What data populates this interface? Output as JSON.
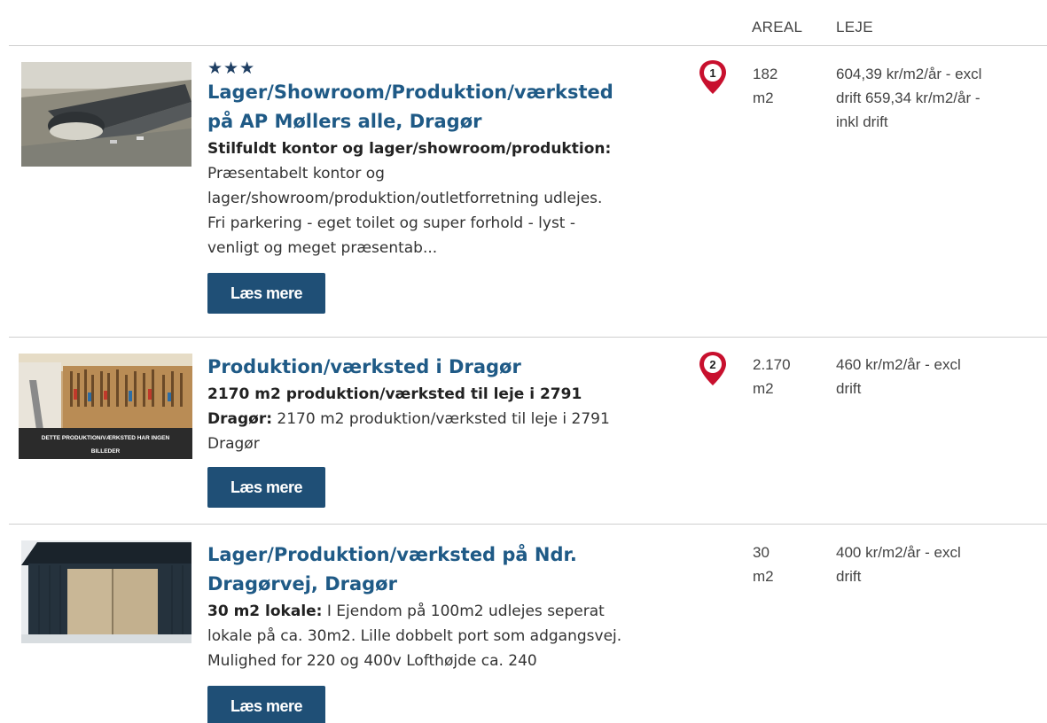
{
  "columns": {
    "areal": "AREAL",
    "leje": "LEJE"
  },
  "listings": [
    {
      "stars": "★★★",
      "title_line1": "Lager/Showroom/Produktion/værksted",
      "title_line2": "på AP Møllers alle, Dragør",
      "subtitle": "Stilfuldt kontor og lager/showroom/produktion:",
      "desc_lines": [
        "Præsentabelt kontor og",
        "lager/showroom/produktion/outletforretning udlejes.",
        "Fri parkering - eget toilet og super forhold - lyst -",
        "venligt og meget præsentab..."
      ],
      "button": "Læs mere",
      "pin_number": "1",
      "areal_lines": [
        "182",
        "m2"
      ],
      "leje_lines": [
        "604,39 kr/m2/år - excl",
        "drift 659,34 kr/m2/år -",
        "inkl drift"
      ]
    },
    {
      "title_line1": "Produktion/værksted i Dragør",
      "subtitle": "2170 m2 produktion/værksted til leje i 2791",
      "desc_bold": "Dragør:",
      "desc_rest": " 2170 m2 produktion/værksted til leje i 2791",
      "desc_line2": "Dragør",
      "image_caption_line1": "DETTE PRODUKTION/VÆRKSTED HAR INGEN",
      "image_caption_line2": "BILLEDER",
      "button": "Læs mere",
      "pin_number": "2",
      "areal_lines": [
        "2.170",
        "m2"
      ],
      "leje_lines": [
        "460 kr/m2/år - excl",
        "drift"
      ]
    },
    {
      "title_line1": "Lager/Produktion/værksted på Ndr.",
      "title_line2": "Dragørvej, Dragør",
      "desc_bold": "30 m2 lokale:",
      "desc_rest": " I Ejendom på 100m2 udlejes seperat",
      "desc_line2": "lokale på ca. 30m2. Lille dobbelt port som adgangsvej.",
      "desc_line3": "Mulighed for 220 og 400v  Lofthøjde ca. 240",
      "button": "Læs mere",
      "areal_lines": [
        "30",
        "m2"
      ],
      "leje_lines": [
        "400 kr/m2/år - excl",
        "drift"
      ]
    }
  ],
  "colors": {
    "title": "#1f5a86",
    "button": "#1f4f76",
    "pin": "#c8102e"
  },
  "icons": {
    "pin": "map-pin-icon"
  }
}
